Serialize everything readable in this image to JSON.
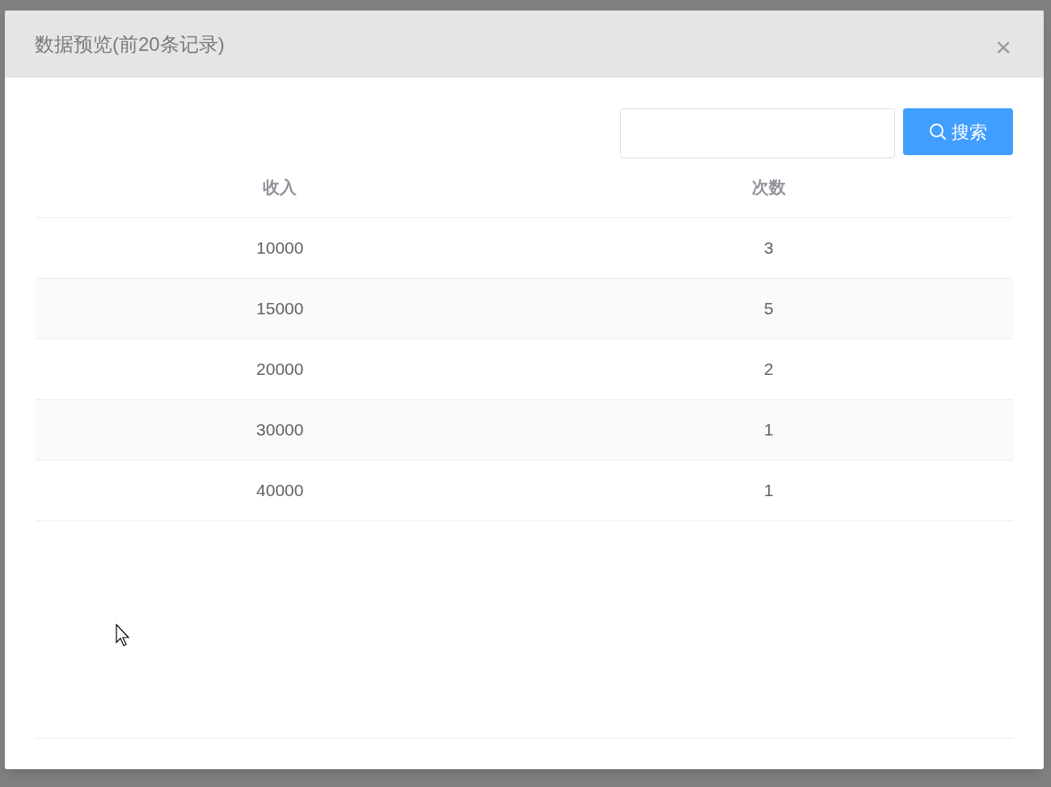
{
  "dialog": {
    "title": "数据预览(前20条记录)",
    "close": "×"
  },
  "search": {
    "button": "搜索"
  },
  "table": {
    "columns": [
      "收入",
      "次数"
    ],
    "rows": [
      {
        "cells": [
          "10000",
          "3"
        ]
      },
      {
        "cells": [
          "15000",
          "5"
        ]
      },
      {
        "cells": [
          "20000",
          "2"
        ]
      },
      {
        "cells": [
          "30000",
          "1"
        ]
      },
      {
        "cells": [
          "40000",
          "1"
        ]
      }
    ]
  }
}
